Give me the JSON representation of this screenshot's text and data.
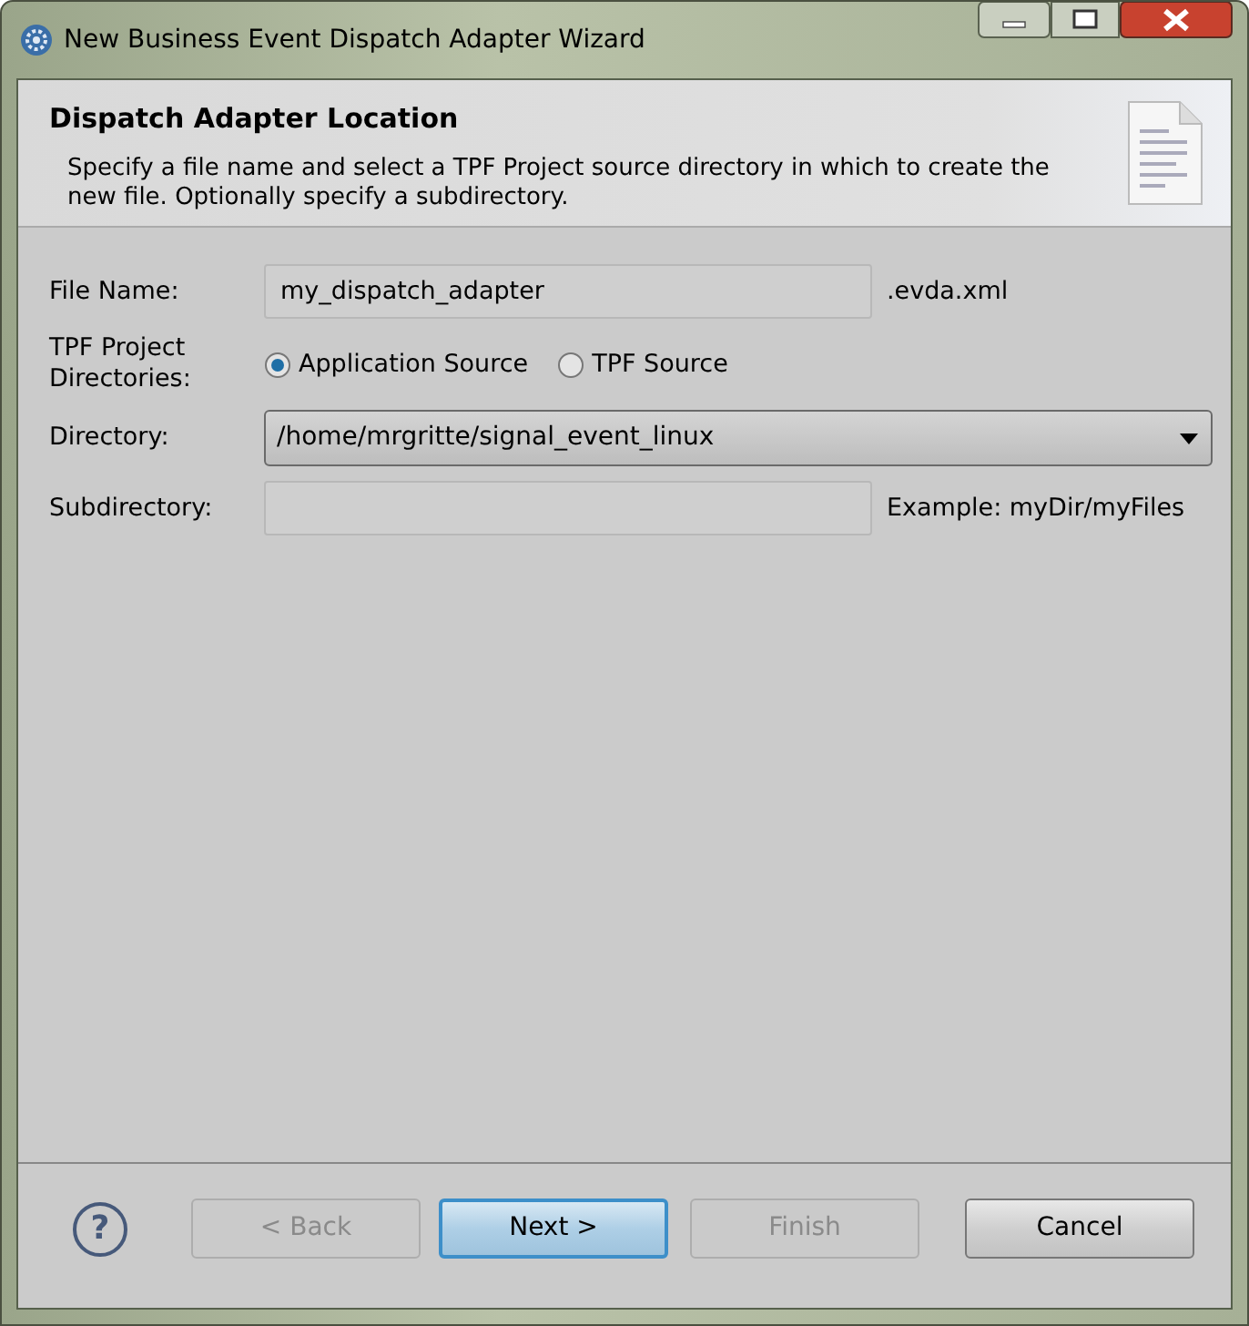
{
  "window": {
    "title": "New Business Event Dispatch Adapter Wizard"
  },
  "header": {
    "title": "Dispatch Adapter Location",
    "description": "Specify a file name and select a TPF Project source directory in which to create the new file. Optionally specify a subdirectory."
  },
  "form": {
    "file_name": {
      "label": "File Name:",
      "value": "my_dispatch_adapter",
      "suffix": ".evda.xml"
    },
    "directories": {
      "label": "TPF Project Directories:",
      "options": [
        {
          "label": "Application Source",
          "selected": true
        },
        {
          "label": "TPF Source",
          "selected": false
        }
      ]
    },
    "directory": {
      "label": "Directory:",
      "value": "/home/mrgritte/signal_event_linux"
    },
    "subdirectory": {
      "label": "Subdirectory:",
      "hint": "Example: myDir/myFiles"
    }
  },
  "help": "?",
  "buttons": [
    {
      "label": "< Back",
      "disabled": true,
      "default": false
    },
    {
      "label": "Next >",
      "disabled": false,
      "default": true
    },
    {
      "label": "Finish",
      "disabled": true,
      "default": false
    },
    {
      "label": "Cancel",
      "disabled": false,
      "default": false
    }
  ]
}
